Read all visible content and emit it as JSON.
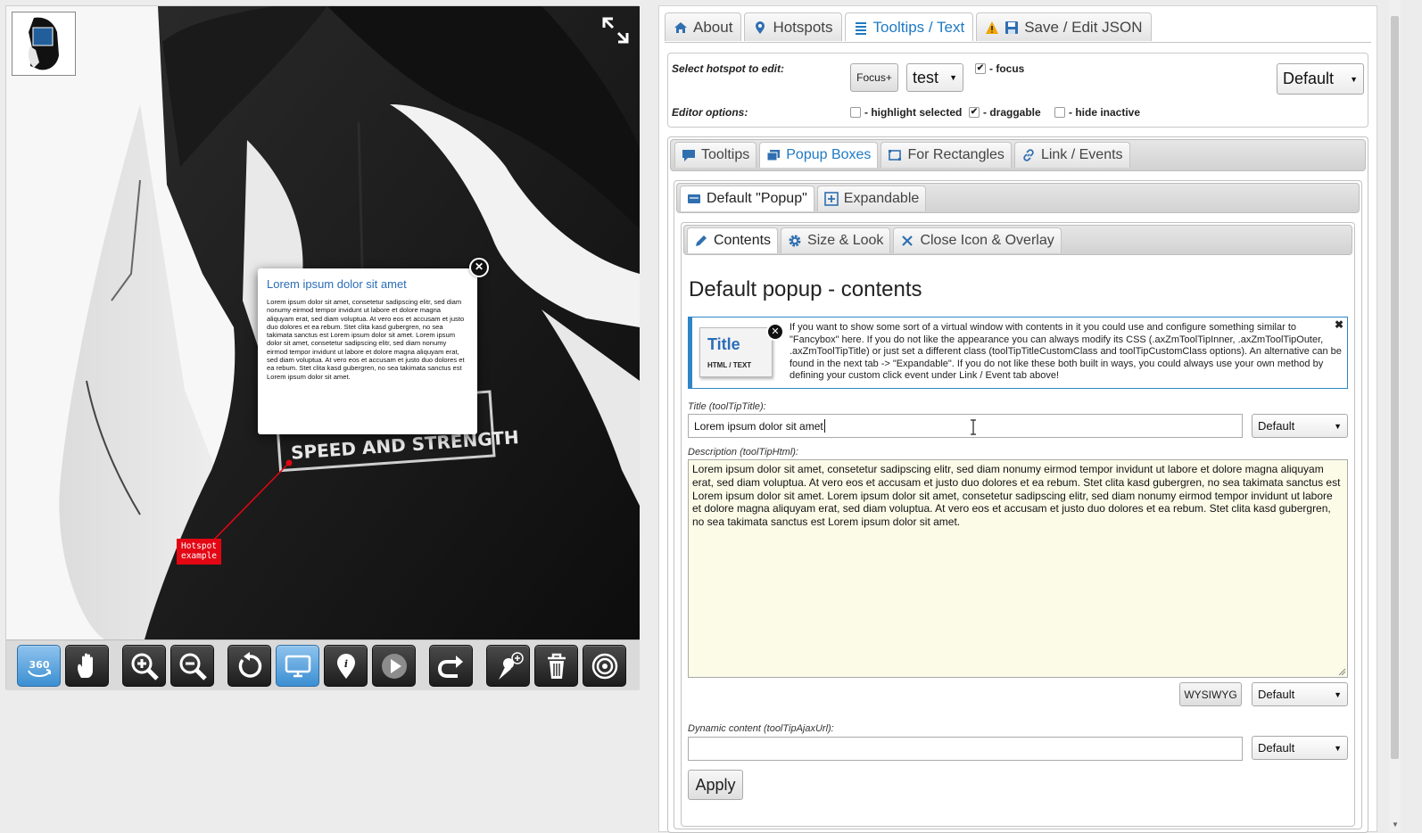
{
  "viewer": {
    "popup": {
      "title": "Lorem ipsum dolor sit amet",
      "body": "Lorem ipsum dolor sit amet, consetetur sadipscing elitr, sed diam nonumy eirmod tempor invidunt ut labore et dolore magna aliquyam erat, sed diam voluptua. At vero eos et accusam et justo duo dolores et ea rebum. Stet clita kasd gubergren, no sea takimata sanctus est Lorem ipsum dolor sit amet. Lorem ipsum dolor sit amet, consetetur sadipscing elitr, sed diam nonumy eirmod tempor invidunt ut labore et dolore magna aliquyam erat, sed diam voluptua. At vero eos et accusam et justo duo dolores et ea rebum. Stet clita kasd gubergren, no sea takimata sanctus est Lorem ipsum dolor sit amet."
    },
    "hotspot": {
      "line1": "Hotspot",
      "line2": "example",
      "color": "#e30613"
    },
    "patch_text": "SPEED AND STRENGTH",
    "toolbar": [
      {
        "name": "360-spin",
        "active": true
      },
      {
        "name": "pan-hand",
        "active": false
      },
      {
        "name": "zoom-in",
        "active": false
      },
      {
        "name": "zoom-out",
        "active": false
      },
      {
        "name": "reset",
        "active": false
      },
      {
        "name": "fullscreen-view",
        "active": true
      },
      {
        "name": "hotspot-info",
        "active": false
      },
      {
        "name": "play",
        "active": false
      },
      {
        "name": "redo",
        "active": false
      },
      {
        "name": "add-hotspot",
        "active": false
      },
      {
        "name": "delete",
        "active": false
      },
      {
        "name": "target",
        "active": false
      }
    ],
    "toolbar_360_label": "360"
  },
  "editor": {
    "main_tabs": [
      {
        "label": "About",
        "icon": "home-icon",
        "active": false
      },
      {
        "label": "Hotspots",
        "icon": "map-marker-icon",
        "active": false
      },
      {
        "label": "Tooltips / Text",
        "icon": "list-icon",
        "active": true
      },
      {
        "label": "Save / Edit JSON",
        "icon": "save-icon",
        "active": false
      }
    ],
    "hotspot_select": {
      "label": "Select hotspot to edit:",
      "focus_button": "Focus+",
      "selected": "test",
      "focus_check_label": "- focus",
      "focus_checked": true,
      "preset_selected": "Default"
    },
    "editor_options": {
      "label": "Editor options:",
      "highlight_label": "- highlight selected",
      "highlight_checked": false,
      "draggable_label": "- draggable",
      "draggable_checked": true,
      "hide_inactive_label": "- hide inactive",
      "hide_inactive_checked": false
    },
    "sub_tabs": [
      {
        "label": "Tooltips",
        "icon": "comment-icon",
        "active": false
      },
      {
        "label": "Popup Boxes",
        "icon": "popup-icon",
        "active": true
      },
      {
        "label": "For Rectangles",
        "icon": "rectangle-icon",
        "active": false
      },
      {
        "label": "Link / Events",
        "icon": "link-icon",
        "active": false
      }
    ],
    "popup_tabs": [
      {
        "label": "Default \"Popup\"",
        "icon": "card-icon",
        "active": true
      },
      {
        "label": "Expandable",
        "icon": "plus-square-icon",
        "active": false
      }
    ],
    "content_tabs": [
      {
        "label": "Contents",
        "icon": "pencil-icon",
        "active": true
      },
      {
        "label": "Size & Look",
        "icon": "gear-icon",
        "active": false
      },
      {
        "label": "Close Icon & Overlay",
        "icon": "close-icon",
        "active": false
      }
    ],
    "content_heading": "Default popup - contents",
    "info": {
      "thumb_title": "Title",
      "thumb_sub": "HTML / TEXT",
      "text": "If you want to show some sort of a virtual window with contents in it you could use and configure something similar to \"Fancybox\" here. If you do not like the appearance you can always modify its CSS (.axZmToolTipInner, .axZmToolTipOuter, .axZmToolTipTitle) or just set a different class (toolTipTitleCustomClass and toolTipCustomClass options). An alternative can be found in the next tab -> \"Expandable\". If you do not like these both built in ways, you could always use your own method by defining your custom click event under Link / Event tab above!",
      "close": "✖"
    },
    "title_field": {
      "label": "Title (toolTipTitle):",
      "value": "Lorem ipsum dolor sit amet",
      "preset": "Default"
    },
    "description_field": {
      "label": "Description (toolTipHtml):",
      "value": "Lorem ipsum dolor sit amet, consetetur sadipscing elitr, sed diam nonumy eirmod tempor invidunt ut labore et dolore magna aliquyam erat, sed diam voluptua. At vero eos et accusam et justo duo dolores et ea rebum. Stet clita kasd gubergren, no sea takimata sanctus est Lorem ipsum dolor sit amet. Lorem ipsum dolor sit amet, consetetur sadipscing elitr, sed diam nonumy eirmod tempor invidunt ut labore et dolore magna aliquyam erat, sed diam voluptua. At vero eos et accusam et justo duo dolores et ea rebum. Stet clita kasd gubergren, no sea takimata sanctus est Lorem ipsum dolor sit amet.",
      "wysiwyg_button": "WYSIWYG",
      "preset": "Default"
    },
    "dynamic_field": {
      "label": "Dynamic content (toolTipAjaxUrl):",
      "value": "",
      "preset": "Default"
    },
    "apply_button": "Apply",
    "colors": {
      "accent": "#1f7ac2",
      "info_border": "#2f86c7",
      "desc_bg": "#fbfbe8"
    }
  }
}
